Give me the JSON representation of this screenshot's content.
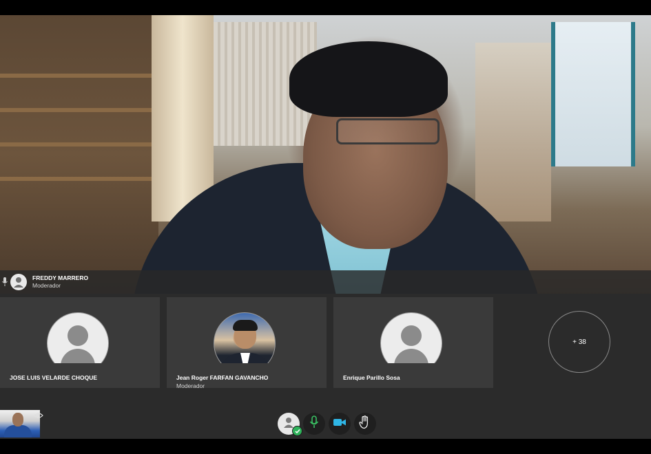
{
  "main_speaker": {
    "name": "FREDDY MARRERO",
    "role": "Moderador",
    "mic_icon": "microphone-icon",
    "avatar_icon": "user-icon"
  },
  "participants": [
    {
      "name": "JOSE LUIS VELARDE CHOQUE",
      "role": "",
      "avatar": "user-placeholder-icon"
    },
    {
      "name": "Jean Roger FARFAN GAVANCHO",
      "role": "Moderador",
      "avatar": "user-photo"
    },
    {
      "name": "Enrique Parillo Sosa",
      "role": "",
      "avatar": "user-placeholder-icon"
    }
  ],
  "more_participants": "+ 38",
  "toolbar": {
    "user_status_icon": "user-status-icon",
    "mic_icon": "microphone-icon",
    "camera_icon": "video-camera-icon",
    "hand_icon": "raise-hand-icon",
    "mic_color": "#3ac063",
    "camera_color": "#2fb6e6"
  },
  "self_view": {
    "eye_icon": "eye-icon"
  }
}
